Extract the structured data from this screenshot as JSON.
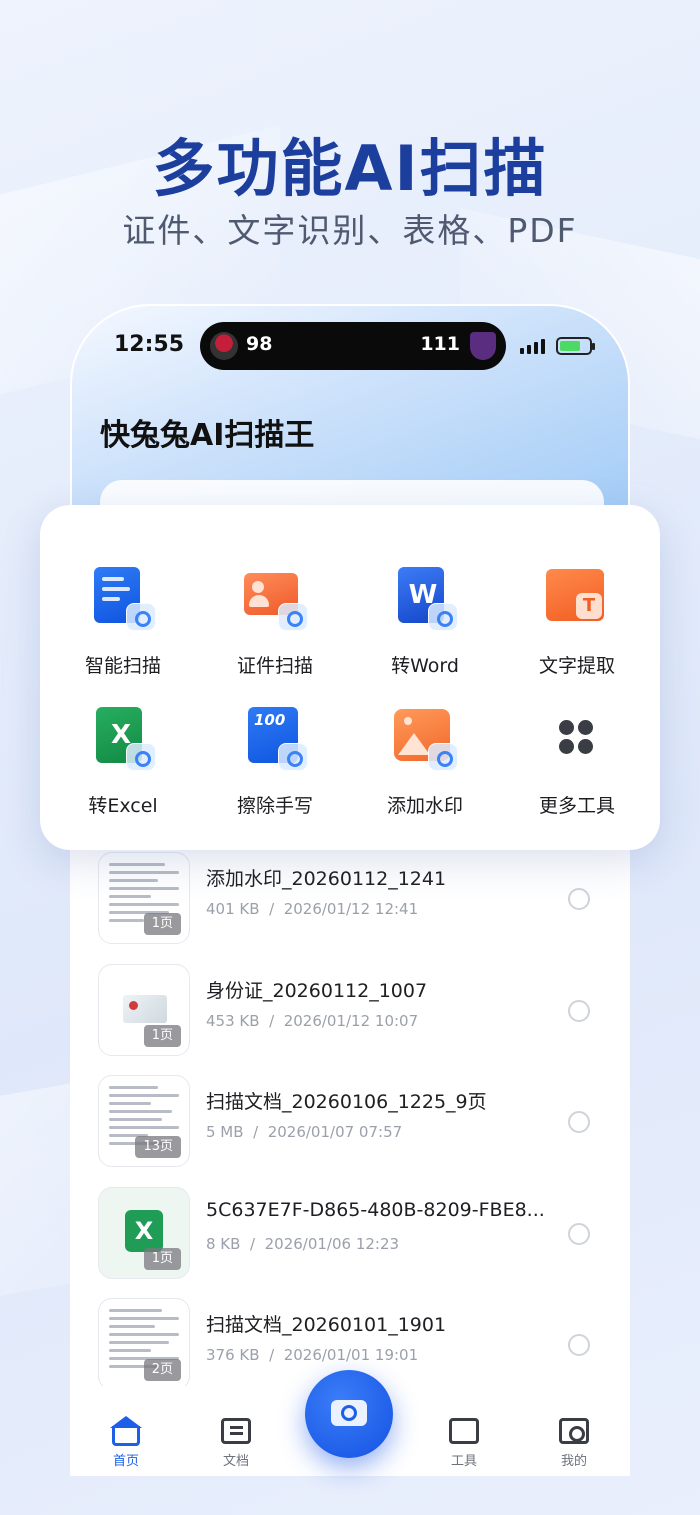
{
  "hero": {
    "title": "多功能AI扫描",
    "subtitle": "证件、文字识别、表格、PDF"
  },
  "status_bar": {
    "time": "12:55",
    "live_activity": {
      "home_score": "98",
      "away_score": "111"
    }
  },
  "app": {
    "title": "快兔兔AI扫描王"
  },
  "tools": [
    {
      "label": "智能扫描",
      "icon": "smart-scan-icon"
    },
    {
      "label": "证件扫描",
      "icon": "id-scan-icon"
    },
    {
      "label": "转Word",
      "icon": "word-convert-icon"
    },
    {
      "label": "文字提取",
      "icon": "text-extract-icon"
    },
    {
      "label": "转Excel",
      "icon": "excel-convert-icon"
    },
    {
      "label": "擦除手写",
      "icon": "erase-handwriting-icon"
    },
    {
      "label": "添加水印",
      "icon": "add-watermark-icon"
    },
    {
      "label": "更多工具",
      "icon": "more-tools-icon"
    }
  ],
  "files": [
    {
      "title": "添加水印_20260112_1241",
      "size": "401 KB",
      "date": "2026/01/12  12:41",
      "pages": "1页",
      "thumb": "document"
    },
    {
      "title": "身份证_20260112_1007",
      "size": "453 KB",
      "date": "2026/01/12  10:07",
      "pages": "1页",
      "thumb": "id-card"
    },
    {
      "title": "扫描文档_20260106_1225_9页",
      "size": "5 MB",
      "date": "2026/01/07  07:57",
      "pages": "13页",
      "thumb": "document"
    },
    {
      "title": "5C637E7F-D865-480B-8209-FBE8...",
      "size": "8 KB",
      "date": "2026/01/06  12:23",
      "pages": "1页",
      "thumb": "excel"
    },
    {
      "title": "扫描文档_20260101_1901",
      "size": "376 KB",
      "date": "2026/01/01  19:01",
      "pages": "2页",
      "thumb": "document"
    }
  ],
  "meta_separator": "/",
  "tabbar": {
    "home": "首页",
    "docs": "文档",
    "tools": "工具",
    "mine": "我的"
  },
  "colors": {
    "accent": "#1d5fe6",
    "hero_title": "#1c3f9e",
    "tool_blue": "#0f55e0",
    "tool_orange": "#f25d22",
    "tool_green": "#1f9d57"
  }
}
